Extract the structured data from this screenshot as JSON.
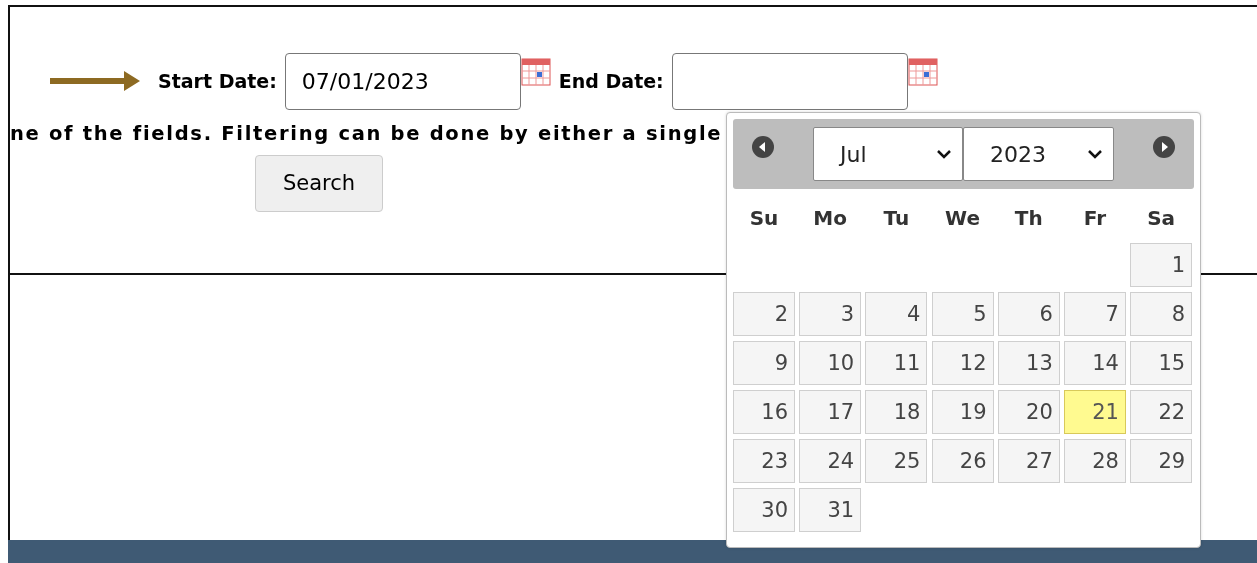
{
  "start_date": {
    "label": "Start Date:",
    "value": "07/01/2023"
  },
  "end_date": {
    "label": "End Date:"
  },
  "instructions": "ne of the fields. Filtering can be done by either a single",
  "search_button": "Search",
  "datepicker": {
    "month": "Jul",
    "year": "2023",
    "weekdays": [
      "Su",
      "Mo",
      "Tu",
      "We",
      "Th",
      "Fr",
      "Sa"
    ],
    "weeks": [
      {
        "kind": "opening",
        "days": [
          {
            "label": "1",
            "selected": false
          }
        ]
      },
      {
        "kind": "full",
        "days": [
          {
            "label": "2",
            "selected": false
          },
          {
            "label": "3",
            "selected": false
          },
          {
            "label": "4",
            "selected": false
          },
          {
            "label": "5",
            "selected": false
          },
          {
            "label": "6",
            "selected": false
          },
          {
            "label": "7",
            "selected": false
          },
          {
            "label": "8",
            "selected": false
          }
        ]
      },
      {
        "kind": "full",
        "days": [
          {
            "label": "9",
            "selected": false
          },
          {
            "label": "10",
            "selected": false
          },
          {
            "label": "11",
            "selected": false
          },
          {
            "label": "12",
            "selected": false
          },
          {
            "label": "13",
            "selected": false
          },
          {
            "label": "14",
            "selected": false
          },
          {
            "label": "15",
            "selected": false
          }
        ]
      },
      {
        "kind": "full",
        "days": [
          {
            "label": "16",
            "selected": false
          },
          {
            "label": "17",
            "selected": false
          },
          {
            "label": "18",
            "selected": false
          },
          {
            "label": "19",
            "selected": false
          },
          {
            "label": "20",
            "selected": false
          },
          {
            "label": "21",
            "selected": true
          },
          {
            "label": "22",
            "selected": false
          }
        ]
      },
      {
        "kind": "full",
        "days": [
          {
            "label": "23",
            "selected": false
          },
          {
            "label": "24",
            "selected": false
          },
          {
            "label": "25",
            "selected": false
          },
          {
            "label": "26",
            "selected": false
          },
          {
            "label": "27",
            "selected": false
          },
          {
            "label": "28",
            "selected": false
          },
          {
            "label": "29",
            "selected": false
          }
        ]
      },
      {
        "kind": "closing",
        "days": [
          {
            "label": "30",
            "selected": false
          },
          {
            "label": "31",
            "selected": false
          }
        ]
      }
    ]
  }
}
